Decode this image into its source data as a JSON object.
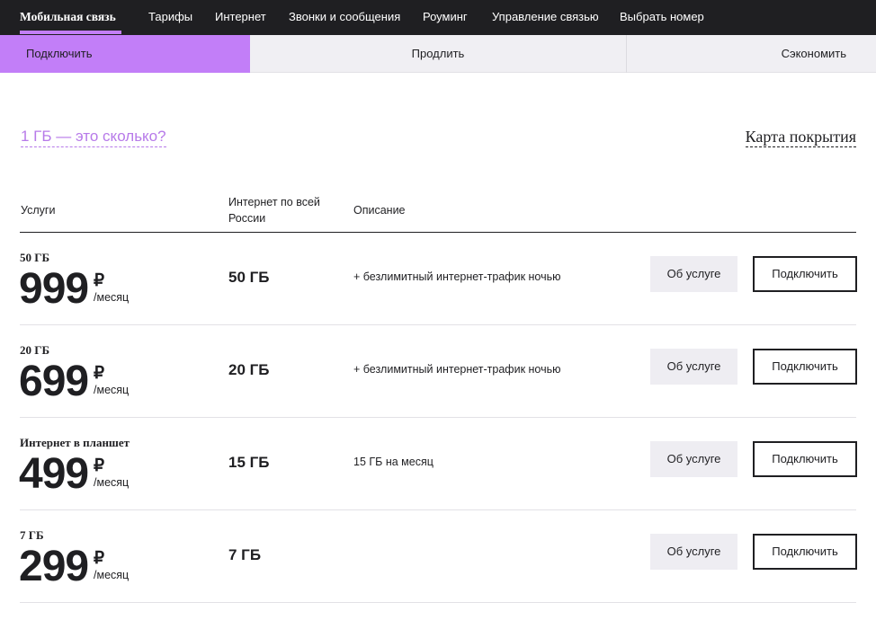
{
  "topnav": {
    "items": [
      "Мобильная связь",
      "Тарифы",
      "Интернет",
      "Звонки и сообщения",
      "Роуминг",
      "Управление связью",
      "Выбрать номер"
    ]
  },
  "subnav": {
    "tabs": [
      "Подключить",
      "Продлить",
      "Сэкономить"
    ]
  },
  "links": {
    "gb_question": "1 ГБ — это сколько?",
    "coverage_map": "Карта покрытия"
  },
  "table": {
    "headers": {
      "services": "Услуги",
      "internet": "Интернет по всей России",
      "description": "Описание"
    },
    "rows": [
      {
        "name": "50 ГБ",
        "price": "999",
        "currency": "₽",
        "period": "/месяц",
        "volume": "50 ГБ",
        "description": "+ безлимитный интернет-трафик ночью",
        "about_label": "Об услуге",
        "connect_label": "Подключить"
      },
      {
        "name": "20 ГБ",
        "price": "699",
        "currency": "₽",
        "period": "/месяц",
        "volume": "20 ГБ",
        "description": "+ безлимитный интернет-трафик ночью",
        "about_label": "Об услуге",
        "connect_label": "Подключить"
      },
      {
        "name": "Интернет в планшет",
        "price": "499",
        "currency": "₽",
        "period": "/месяц",
        "volume": "15 ГБ",
        "description": "15 ГБ на месяц",
        "about_label": "Об услуге",
        "connect_label": "Подключить"
      },
      {
        "name": "7 ГБ",
        "price": "299",
        "currency": "₽",
        "period": "/месяц",
        "volume": "7 ГБ",
        "description": "",
        "about_label": "Об услуге",
        "connect_label": "Подключить"
      }
    ]
  },
  "colors": {
    "accent": "#c27ef8",
    "nav_bg": "#1f1f22",
    "link_purple": "#b77ae9"
  }
}
